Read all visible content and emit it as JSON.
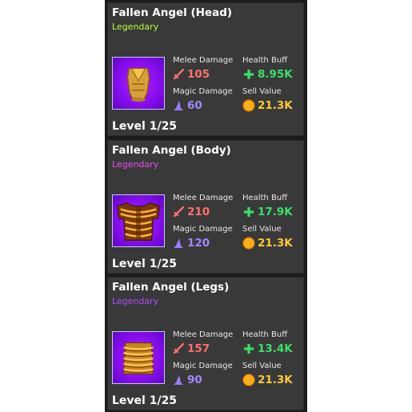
{
  "cards": [
    {
      "title": "Fallen Angel (Head)",
      "rarity": "Legendary",
      "rarity_color": "#b7ff3a",
      "melee_label": "Melee Damage",
      "melee_value": "105",
      "health_label": "Health Buff",
      "health_value": "8.95K",
      "magic_label": "Magic Damage",
      "magic_value": "60",
      "sell_label": "Sell Value",
      "sell_value": "21.3K",
      "level": "Level 1/25",
      "icon": "helmet-icon"
    },
    {
      "title": "Fallen Angel (Body)",
      "rarity": "Legendary",
      "rarity_color": "#e64ff0",
      "melee_label": "Melee Damage",
      "melee_value": "210",
      "health_label": "Health Buff",
      "health_value": "17.9K",
      "magic_label": "Magic Damage",
      "magic_value": "120",
      "sell_label": "Sell Value",
      "sell_value": "21.3K",
      "level": "Level 1/25",
      "icon": "chestplate-icon"
    },
    {
      "title": "Fallen Angel (Legs)",
      "rarity": "Legendary",
      "rarity_color": "#b14bff",
      "melee_label": "Melee Damage",
      "melee_value": "157",
      "health_label": "Health Buff",
      "health_value": "13.4K",
      "magic_label": "Magic Damage",
      "magic_value": "90",
      "sell_label": "Sell Value",
      "sell_value": "21.3K",
      "level": "Level 1/25",
      "icon": "leggings-icon"
    }
  ],
  "colors": {
    "melee": "#ff6f6f",
    "magic": "#a387ff",
    "health": "#3ae06a",
    "sell": "#ffc93a"
  }
}
